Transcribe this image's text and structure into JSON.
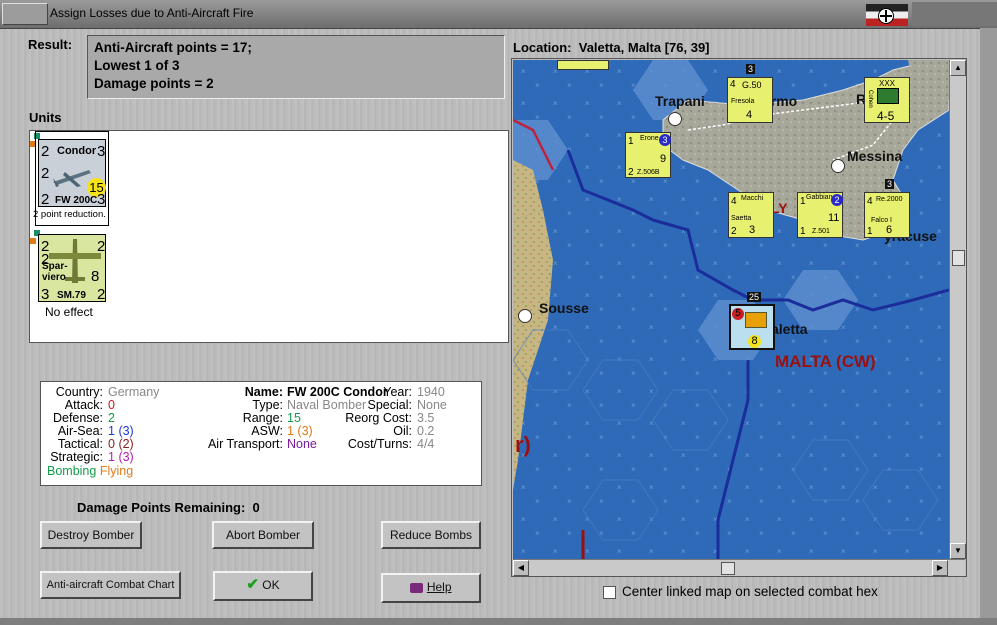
{
  "window": {
    "title": "Assign Losses due to Anti-Aircraft Fire"
  },
  "result": {
    "label": "Result:",
    "lines": [
      "Anti-Aircraft points = 17;",
      "Lowest 1 of 3",
      "Damage points = 2"
    ]
  },
  "units": {
    "label": "Units",
    "items": [
      {
        "name": "Condor",
        "type": "FW 200C",
        "tl": "2",
        "tr": "3",
        "ml": "2",
        "bl": "2",
        "br": "3",
        "value": "15",
        "status": "2 point reduction."
      },
      {
        "name_top": "Spar-",
        "name_bottom": "viero",
        "type": "SM.79",
        "tl": "2",
        "tr": "2",
        "ml": "2",
        "bl": "3",
        "br": "2",
        "value": "8",
        "status": "No effect"
      }
    ]
  },
  "details": {
    "country_label": "Country:",
    "country": "Germany",
    "attack_label": "Attack:",
    "attack": "0",
    "defense_label": "Defense:",
    "defense": "2",
    "airsea_label": "Air-Sea:",
    "airsea": "1",
    "airsea_paren": "(3)",
    "tactical_label": "Tactical:",
    "tactical": "0",
    "tactical_paren": "(2)",
    "strategic_label": "Strategic:",
    "strategic": "1",
    "strategic_paren": "(3)",
    "bombing": "Bombing",
    "flying": "Flying",
    "name_label": "Name:",
    "name": "FW 200C Condor",
    "type_label": "Type:",
    "type": "Naval Bomber",
    "range_label": "Range:",
    "range": "15",
    "asw_label": "ASW:",
    "asw": "1 (3)",
    "airtransport_label": "Air Transport:",
    "airtransport": "None",
    "year_label": "Year:",
    "year": "1940",
    "special_label": "Special:",
    "special": "None",
    "reorg_label": "Reorg Cost:",
    "reorg": "3.5",
    "oil_label": "Oil:",
    "oil": "0.2",
    "costturns_label": "Cost/Turns:",
    "costturns": "4/4"
  },
  "damage": {
    "label": "Damage Points Remaining:",
    "value": "0"
  },
  "buttons": {
    "destroy": "Destroy Bomber",
    "abort": "Abort Bomber",
    "reduce": "Reduce Bombs",
    "chart": "Anti-aircraft Combat Chart",
    "ok": "OK",
    "help": "Help"
  },
  "map": {
    "location_label": "Location:",
    "location": "Valetta, Malta [76, 39]",
    "places": [
      "Trapani",
      "ermo",
      "R",
      "Messina",
      "LY",
      "yracuse",
      "Sousse",
      "aletta",
      "MALTA (CW)",
      "r)"
    ],
    "counters": [
      {
        "top": "G.50",
        "name": "Fresola",
        "tl": "4",
        "v": "4",
        "stack": "3"
      },
      {
        "top": "XXX",
        "name": "Cohen",
        "v": "4-5"
      },
      {
        "top": "Erone",
        "name": "Z.506B",
        "tl": "1",
        "v": "9",
        "b": "2",
        "badge": "3"
      },
      {
        "top": "Macchi",
        "name": "Saetta",
        "tl": "4",
        "v": "3",
        "b": "2"
      },
      {
        "top": "Gabbiano",
        "name": "Z.501",
        "tl": "1",
        "v": "11",
        "b": "1",
        "badge": "2"
      },
      {
        "top": "Re.2000",
        "name": "Falco I",
        "tl": "4",
        "v": "6",
        "b": "1",
        "stack": "3"
      },
      {
        "top": "",
        "name": "",
        "tl": "5",
        "v": "8",
        "stack": "25"
      }
    ]
  },
  "center_link": {
    "label": "Center linked map on selected combat hex",
    "checked": false
  }
}
